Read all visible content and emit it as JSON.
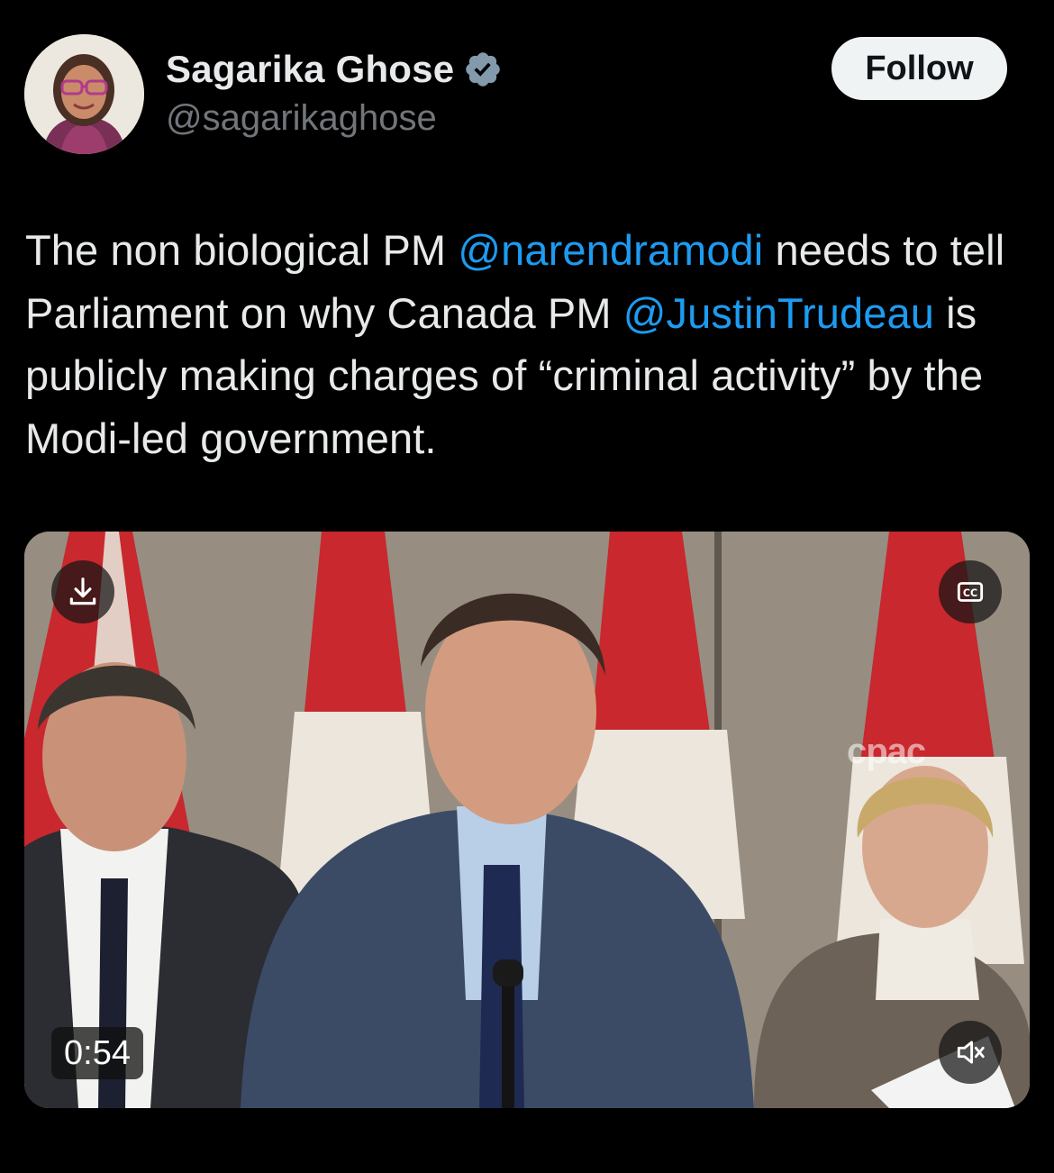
{
  "tweet": {
    "author": {
      "display_name": "Sagarika Ghose",
      "handle": "@sagarikaghose",
      "verified": true,
      "avatar_icon": "profile-photo"
    },
    "follow_label": "Follow",
    "text_parts": [
      {
        "type": "text",
        "value": "The non biological PM "
      },
      {
        "type": "mention",
        "value": "@narendramodi"
      },
      {
        "type": "text",
        "value": " needs to tell Parliament on why Canada PM "
      },
      {
        "type": "mention",
        "value": "@JustinTrudeau"
      },
      {
        "type": "text",
        "value": " is publicly making charges of “criminal activity” by the Modi-led government."
      }
    ],
    "media": {
      "duration": "0:54",
      "watermark": "cpac",
      "controls": {
        "download_icon": "download-icon",
        "captions_icon": "closed-captions-icon",
        "mute_icon": "muted-speaker-icon"
      }
    }
  },
  "colors": {
    "background": "#000000",
    "text_primary": "#e7e9ea",
    "text_secondary": "#71767b",
    "link": "#1d9bf0",
    "follow_bg": "#eff3f4",
    "verified": "#1d9bf0"
  }
}
